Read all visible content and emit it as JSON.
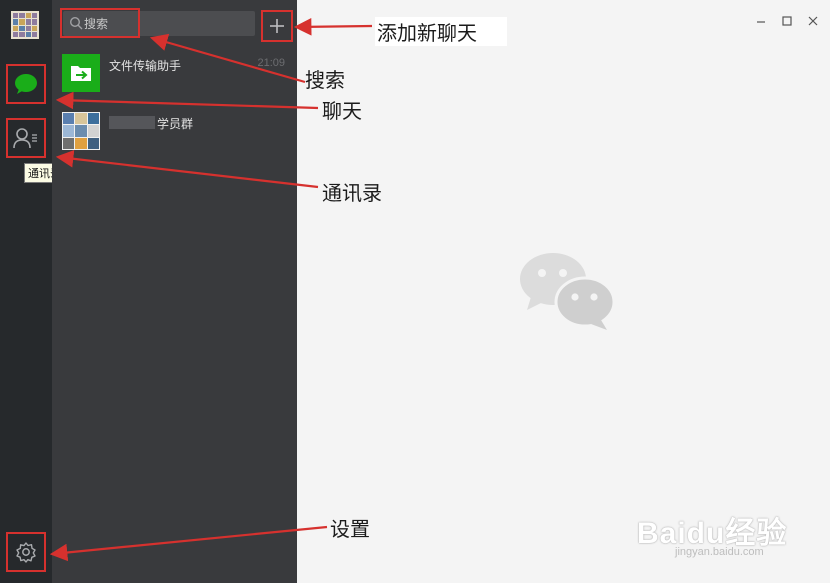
{
  "search": {
    "placeholder": "搜索"
  },
  "sidebar": {
    "contacts_tooltip": "通讯录"
  },
  "chats": [
    {
      "name": "文件传输助手",
      "time": "21:09"
    },
    {
      "name": "学员群",
      "time": ""
    }
  ],
  "watermark": {
    "brand": "Baidu经验",
    "url": "jingyan.baidu.com"
  },
  "annotations": {
    "add_chat": "添加新聊天",
    "search": "搜索",
    "chat": "聊天",
    "contacts": "通讯录",
    "settings": "设置"
  },
  "colors": {
    "rail_bg": "#26292c",
    "list_bg": "#393a3d",
    "main_bg": "#f4f4f4",
    "accent_green": "#1aad19",
    "annotation_red": "#d6312e"
  },
  "icons": [
    "chat-bubble-icon",
    "contacts-icon",
    "gear-icon",
    "search-icon",
    "plus-icon",
    "file-transfer-icon",
    "wechat-logo-icon"
  ]
}
